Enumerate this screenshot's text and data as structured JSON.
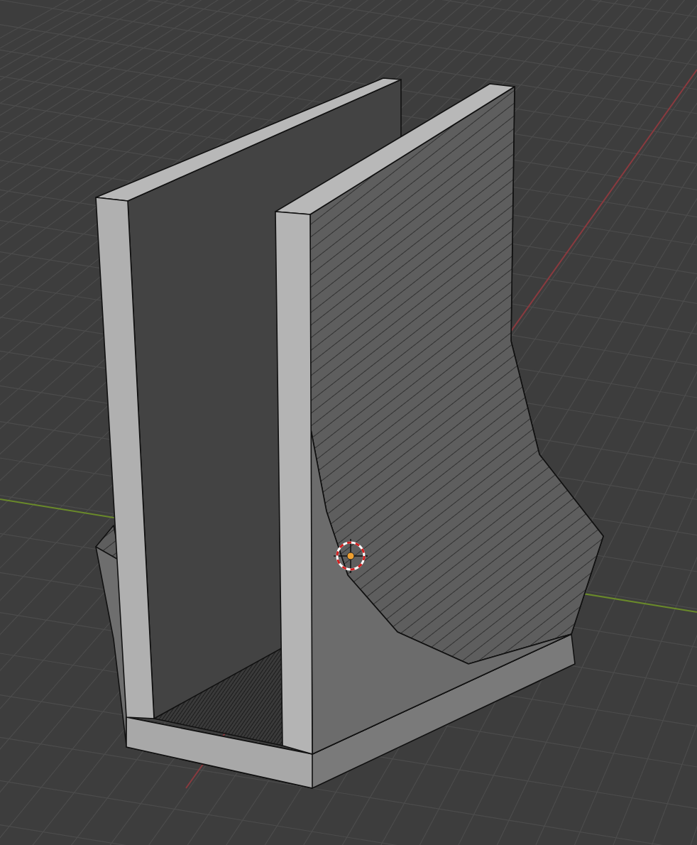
{
  "viewport": {
    "cursor_shown": true,
    "object_origin_shown": true
  }
}
